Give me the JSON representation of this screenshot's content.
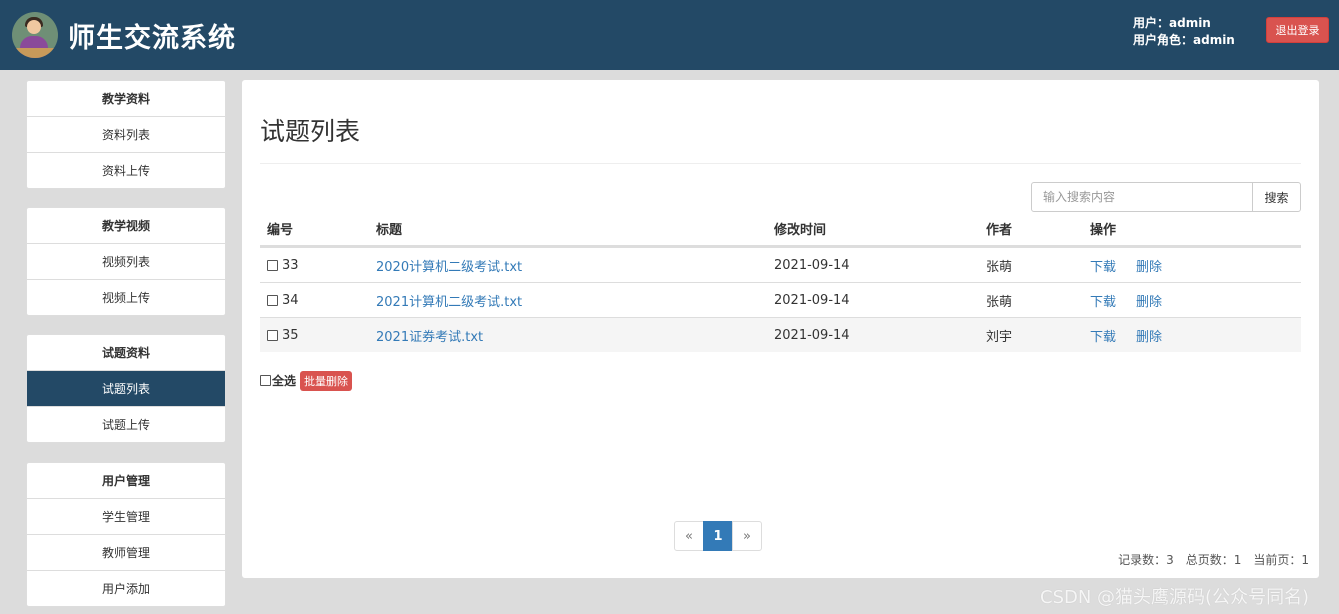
{
  "header": {
    "app_title": "师生交流系统",
    "user_line": "用户：admin",
    "role_line": "用户角色：admin",
    "logout_label": "退出登录",
    "brand_color": "#234966"
  },
  "sidebar": {
    "groups": [
      {
        "title": "教学资料",
        "items": [
          {
            "label": "资料列表"
          },
          {
            "label": "资料上传"
          }
        ]
      },
      {
        "title": "教学视频",
        "items": [
          {
            "label": "视频列表"
          },
          {
            "label": "视频上传"
          }
        ]
      },
      {
        "title": "试题资料",
        "items": [
          {
            "label": "试题列表",
            "active": true
          },
          {
            "label": "试题上传"
          }
        ]
      },
      {
        "title": "用户管理",
        "items": [
          {
            "label": "学生管理"
          },
          {
            "label": "教师管理"
          },
          {
            "label": "用户添加"
          }
        ]
      }
    ]
  },
  "main": {
    "page_title": "试题列表",
    "search": {
      "placeholder": "输入搜索内容",
      "button_label": "搜索"
    },
    "table": {
      "columns": [
        "编号",
        "标题",
        "修改时间",
        "作者",
        "操作"
      ],
      "rows": [
        {
          "id": "33",
          "title": "2020计算机二级考试.txt",
          "modified": "2021-09-14",
          "author": "张萌",
          "download": "下载",
          "delete": "删除"
        },
        {
          "id": "34",
          "title": "2021计算机二级考试.txt",
          "modified": "2021-09-14",
          "author": "张萌",
          "download": "下载",
          "delete": "删除"
        },
        {
          "id": "35",
          "title": "2021证券考试.txt",
          "modified": "2021-09-14",
          "author": "刘宇",
          "download": "下载",
          "delete": "删除"
        }
      ]
    },
    "select_all_label": "全选",
    "batch_delete_label": "批量删除",
    "pagination": {
      "prev": "«",
      "current": "1",
      "next": "»"
    },
    "stats": {
      "records": "记录数：3",
      "total_pages": "总页数：1",
      "current_page": "当前页：1"
    }
  },
  "watermark": "CSDN @猫头鹰源码(公众号同名)"
}
